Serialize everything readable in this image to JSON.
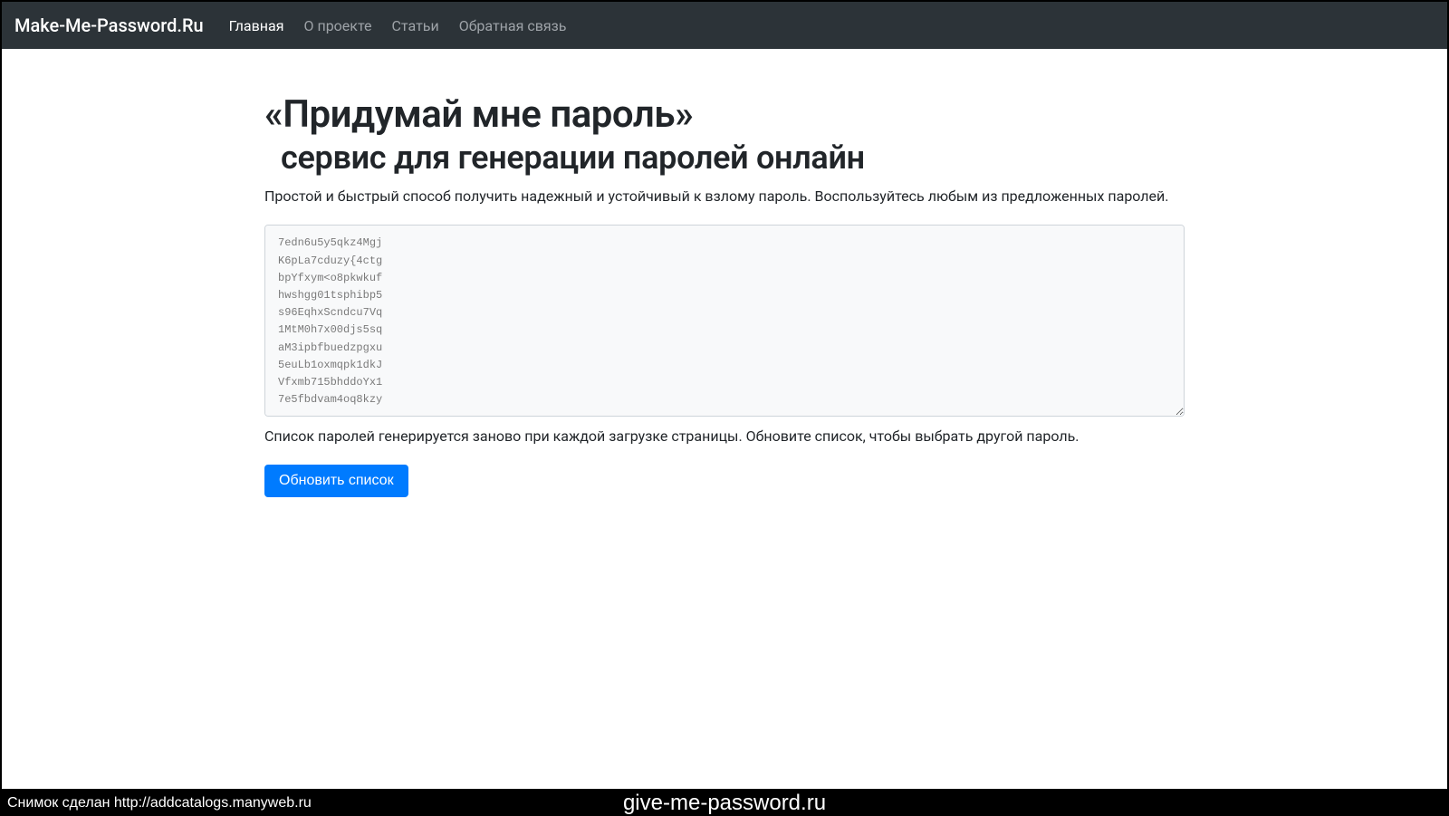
{
  "navbar": {
    "brand": "Make-Me-Password.Ru",
    "links": [
      {
        "label": "Главная",
        "active": true
      },
      {
        "label": "О проекте",
        "active": false
      },
      {
        "label": "Статьи",
        "active": false
      },
      {
        "label": "Обратная связь",
        "active": false
      }
    ]
  },
  "main": {
    "title_line1": "«Придумай мне пароль»",
    "title_line2": "сервис для генерации паролей онлайн",
    "lead": "Простой и быстрый способ получить надежный и устойчивый к взлому пароль. Воспользуйтесь любым из предложенных паролей.",
    "passwords": "7edn6u5y5qkz4Mgj\nK6pLa7cduzy{4ctg\nbpYfxym<o8pkwkuf\nhwshgg01tsphibp5\ns96EqhxScndcu7Vq\n1MtM0h7x00djs5sq\naM3ipbfbuedzpgxu\n5euLb1oxmqpk1dkJ\nVfxmb715bhddoYx1\n7e5fbdvam4oq8kzy",
    "help": "Список паролей генерируется заново при каждой загрузке страницы. Обновите список, чтобы выбрать другой пароль.",
    "refresh_label": "Обновить список"
  },
  "footer": {
    "left": "Снимок сделан http://addcatalogs.manyweb.ru",
    "center": "give-me-password.ru"
  }
}
